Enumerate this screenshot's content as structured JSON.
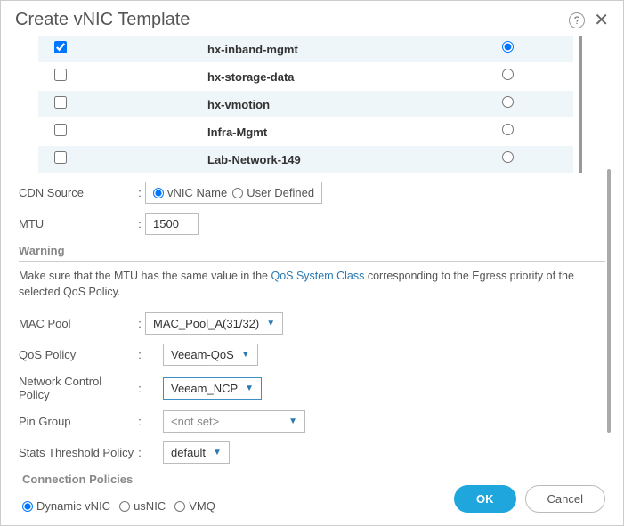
{
  "dialog": {
    "title": "Create vNIC Template",
    "help": "?",
    "close": "✕"
  },
  "vlans": [
    {
      "name": "hx-inband-mgmt",
      "checked": true,
      "native": true
    },
    {
      "name": "hx-storage-data",
      "checked": false,
      "native": false
    },
    {
      "name": "hx-vmotion",
      "checked": false,
      "native": false
    },
    {
      "name": "Infra-Mgmt",
      "checked": false,
      "native": false
    },
    {
      "name": "Lab-Network-149",
      "checked": false,
      "native": false
    }
  ],
  "cdn": {
    "label": "CDN Source",
    "opt1": "vNIC Name",
    "opt2": "User Defined",
    "selected": "vNIC Name"
  },
  "mtu": {
    "label": "MTU",
    "value": "1500"
  },
  "warning": {
    "heading": "Warning",
    "text1": "Make sure that the MTU has the same value in the ",
    "link": "QoS System Class",
    "text2": " corresponding to the Egress priority of the selected QoS Policy."
  },
  "macpool": {
    "label": "MAC Pool",
    "value": "MAC_Pool_A(31/32)"
  },
  "qos": {
    "label": "QoS Policy",
    "value": "Veeam-QoS"
  },
  "ncp": {
    "label": "Network Control Policy",
    "value": "Veeam_NCP"
  },
  "pingroup": {
    "label": "Pin Group",
    "value": "<not set>"
  },
  "stats": {
    "label": "Stats Threshold Policy",
    "value": "default"
  },
  "conn": {
    "heading": "Connection Policies",
    "opt1": "Dynamic vNIC",
    "opt2": "usNIC",
    "opt3": "VMQ",
    "selected": "Dynamic vNIC"
  },
  "footer": {
    "ok": "OK",
    "cancel": "Cancel"
  }
}
